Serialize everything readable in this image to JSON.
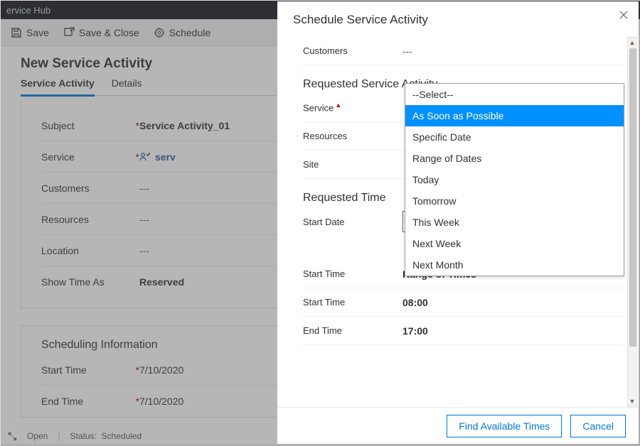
{
  "app_header": "ervice Hub",
  "commands": {
    "save": "Save",
    "save_close": "Save & Close",
    "schedule": "Schedule"
  },
  "form_title": "New Service Activity",
  "tabs": [
    "Service Activity",
    "Details"
  ],
  "form": {
    "subject_label": "Subject",
    "subject_value": "Service Activity_01",
    "service_label": "Service",
    "service_value": "serv",
    "customers_label": "Customers",
    "customers_value": "---",
    "resources_label": "Resources",
    "resources_value": "---",
    "location_label": "Location",
    "location_value": "---",
    "showtime_label": "Show Time As",
    "showtime_value": "Reserved"
  },
  "sched_section_title": "Scheduling Information",
  "sched": {
    "start_label": "Start Time",
    "start_value": "7/10/2020",
    "end_label": "End Time",
    "end_value": "7/10/2020"
  },
  "statusbar": {
    "state": "Open",
    "status_label": "Status:",
    "status_value": "Scheduled"
  },
  "panel": {
    "title": "Schedule Service Activity",
    "customers_label": "Customers",
    "customers_value": "---",
    "req_section": "Requested Service Activity",
    "service_label": "Service",
    "resources_label": "Resources",
    "site_label": "Site",
    "time_section": "Requested Time",
    "startdate_label": "Start Date",
    "startdate_value": "As Soon as Possible",
    "starttime_hdr_label": "Start Time",
    "starttime_hdr_value": "Range of Times",
    "starttime_label": "Start Time",
    "starttime_value": "08:00",
    "endtime_label": "End Time",
    "endtime_value": "17:00"
  },
  "dropdown_options": [
    "--Select--",
    "As Soon as Possible",
    "Specific Date",
    "Range of Dates",
    "Today",
    "Tomorrow",
    "This Week",
    "Next Week",
    "Next Month"
  ],
  "dropdown_selected_index": 1,
  "buttons": {
    "find": "Find Available Times",
    "cancel": "Cancel"
  },
  "required_mark": "*"
}
